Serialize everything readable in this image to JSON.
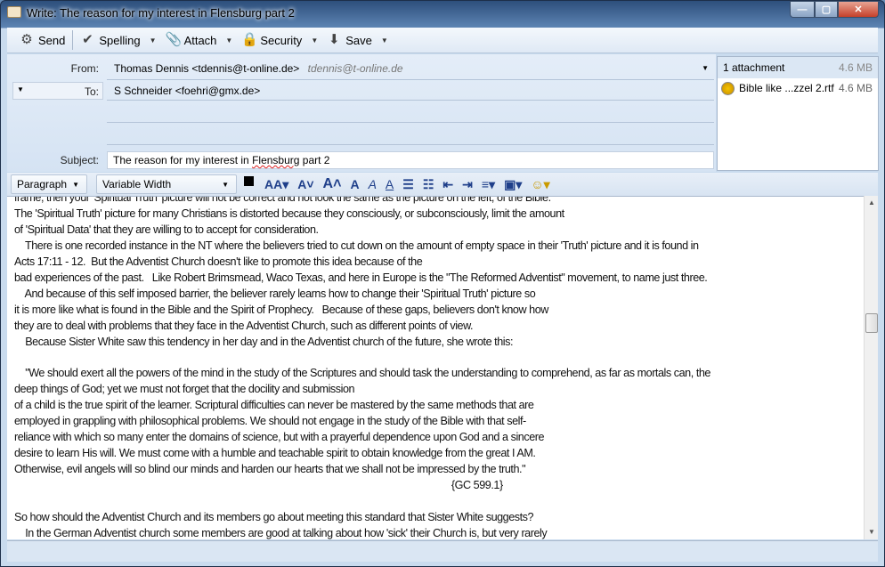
{
  "window": {
    "title": "Write: The reason for my interest in Flensburg part 2",
    "min": "—",
    "max": "▢",
    "close": "✕"
  },
  "toolbar": {
    "send": "Send",
    "spelling": "Spelling",
    "attach": "Attach",
    "security": "Security",
    "save": "Save"
  },
  "header": {
    "from_label": "From:",
    "from_value": "Thomas Dennis <tdennis@t-online.de>",
    "from_hint": "tdennis@t-online.de",
    "to_label": "To:",
    "to_value": "S Schneider <foehri@gmx.de>",
    "subject_label": "Subject:",
    "subject_value_pre": "The reason for my interest in ",
    "subject_value_misspelled": "Flensburg",
    "subject_value_post": " part 2"
  },
  "attachments": {
    "header": "1 attachment",
    "total_size": "4.6 MB",
    "items": [
      {
        "name": "Bible like ...zzel 2.rtf",
        "size": "4.6 MB"
      }
    ]
  },
  "format": {
    "paragraph": "Paragraph",
    "font": "Variable Width"
  },
  "body": {
    "lines": [
      "frame, then your 'Spiritual Truth' picture will not be correct and not look the same as the picture on the left, of the Bible.",
      "The 'Spiritual Truth' picture for many Christians is distorted because they consciously, or subconsciously, limit the amount",
      "of 'Spiritual Data' that they are willing to to accept for consideration.",
      "    There is one recorded instance in the NT where the believers tried to cut down on the amount of empty space in their 'Truth' picture and it is found in",
      "Acts 17:11 - 12.  But the Adventist Church doesn't like to promote this idea because of the",
      "bad experiences of the past.   Like Robert Brimsmead, Waco Texas, and here in Europe is the \"The Reformed Adventist\" movement, to name just three.",
      "    And because of this self imposed barrier, the believer rarely learns how to change their 'Spiritual Truth' picture so",
      "it is more like what is found in the Bible and the Spirit of Prophecy.   Because of these gaps, believers don't know how",
      "they are to deal with problems that they face in the Adventist Church, such as different points of view.",
      "    Because Sister White saw this tendency in her day and in the Adventist church of the future, she wrote this:",
      "",
      "    \"We should exert all the powers of the mind in the study of the Scriptures and should task the understanding to comprehend, as far as mortals can, the",
      "deep things of God; yet we must not forget that the docility and submission",
      "of a child is the true spirit of the learner. Scriptural difficulties can never be mastered by the same methods that are",
      "employed in grappling with philosophical problems. We should not engage in the study of the Bible with that self-",
      "reliance with which so many enter the domains of science, but with a prayerful dependence upon God and a sincere",
      "desire to learn His will. We must come with a humble and teachable spirit to obtain knowledge from the great I AM.",
      "Otherwise, evil angels will so blind our minds and harden our hearts that we shall not be impressed by the truth.\"",
      "                                                                                                                                                                 {GC 599.1}",
      "",
      "So how should the Adventist Church and its members go about meeting this standard that Sister White suggests?",
      "    In the German Adventist church some members are good at talking about how 'sick' their Church is, but very rarely"
    ]
  }
}
